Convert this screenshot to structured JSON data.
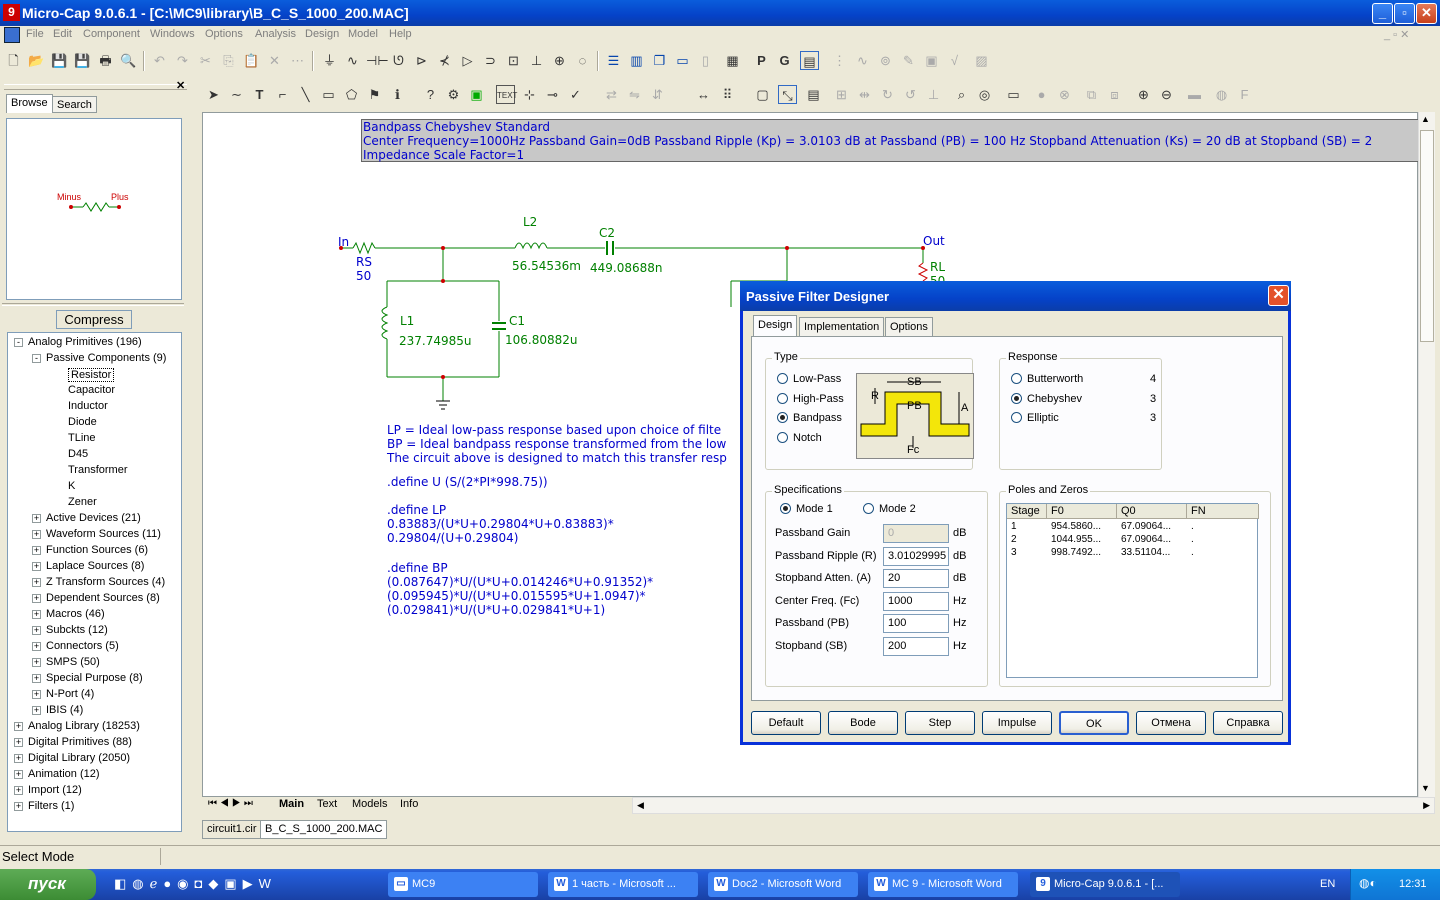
{
  "window": {
    "title": "Micro-Cap 9.0.6.1 - [C:\\MC9\\library\\B_C_S_1000_200.MAC]",
    "min": "_",
    "max": "▫",
    "close": "✕"
  },
  "menu": [
    "File",
    "Edit",
    "Component",
    "Windows",
    "Options",
    "Analysis",
    "Design",
    "Model",
    "Help"
  ],
  "left": {
    "tabs": [
      "Browse",
      "Search"
    ],
    "preview_pins": {
      "minus": "Minus",
      "plus": "Plus"
    },
    "compress": "Compress",
    "tree": [
      {
        "label": "Analog Primitives (196)",
        "level": 0,
        "exp": "-"
      },
      {
        "label": "Passive Components (9)",
        "level": 1,
        "exp": "-"
      },
      {
        "label": "Resistor",
        "level": 2,
        "exp": "",
        "sel": true
      },
      {
        "label": "Capacitor",
        "level": 2,
        "exp": ""
      },
      {
        "label": "Inductor",
        "level": 2,
        "exp": ""
      },
      {
        "label": "Diode",
        "level": 2,
        "exp": ""
      },
      {
        "label": "TLine",
        "level": 2,
        "exp": ""
      },
      {
        "label": "D45",
        "level": 2,
        "exp": ""
      },
      {
        "label": "Transformer",
        "level": 2,
        "exp": ""
      },
      {
        "label": "K",
        "level": 2,
        "exp": ""
      },
      {
        "label": "Zener",
        "level": 2,
        "exp": ""
      },
      {
        "label": "Active Devices (21)",
        "level": 1,
        "exp": "+"
      },
      {
        "label": "Waveform Sources (11)",
        "level": 1,
        "exp": "+"
      },
      {
        "label": "Function Sources (6)",
        "level": 1,
        "exp": "+"
      },
      {
        "label": "Laplace Sources (8)",
        "level": 1,
        "exp": "+"
      },
      {
        "label": "Z Transform Sources (4)",
        "level": 1,
        "exp": "+"
      },
      {
        "label": "Dependent Sources (8)",
        "level": 1,
        "exp": "+"
      },
      {
        "label": "Macros (46)",
        "level": 1,
        "exp": "+"
      },
      {
        "label": "Subckts (12)",
        "level": 1,
        "exp": "+"
      },
      {
        "label": "Connectors (5)",
        "level": 1,
        "exp": "+"
      },
      {
        "label": "SMPS (50)",
        "level": 1,
        "exp": "+"
      },
      {
        "label": "Special Purpose (8)",
        "level": 1,
        "exp": "+"
      },
      {
        "label": "N-Port (4)",
        "level": 1,
        "exp": "+"
      },
      {
        "label": "IBIS (4)",
        "level": 1,
        "exp": "+"
      },
      {
        "label": "Analog Library (18253)",
        "level": 0,
        "exp": "+"
      },
      {
        "label": "Digital Primitives (88)",
        "level": 0,
        "exp": "+"
      },
      {
        "label": "Digital Library (2050)",
        "level": 0,
        "exp": "+"
      },
      {
        "label": "Animation (12)",
        "level": 0,
        "exp": "+"
      },
      {
        "label": "Import (12)",
        "level": 0,
        "exp": "+"
      },
      {
        "label": "Filters (1)",
        "level": 0,
        "exp": "+"
      }
    ]
  },
  "schematic": {
    "header": [
      "Bandpass Chebyshev Standard",
      "Center Frequency=1000Hz Passband Gain=0dB Passband Ripple (Kp) = 3.0103 dB at Passband (PB) = 100 Hz  Stopband Attenuation (Ks) = 20 dB at Stopband (SB) = 2",
      "Impedance Scale Factor=1"
    ],
    "labels": {
      "in": "In",
      "out": "Out",
      "rs": "RS",
      "rs_val": "50",
      "l2": "L2",
      "l2_val": "56.54536m",
      "c2": "C2",
      "c2_val": "449.08688n",
      "l1": "L1",
      "l1_val": "237.74985u",
      "c1": "C1",
      "c1_val": "106.80882u",
      "rl": "RL",
      "rl_val": "50"
    },
    "notes": [
      "LP = Ideal low-pass response based upon choice of filte",
      "BP = Ideal bandpass response transformed from the low",
      "The circuit above is designed to match this transfer resp"
    ],
    "defines": [
      ".define U (S/(2*PI*998.75))",
      ".define LP",
      "0.83883/(U*U+0.29804*U+0.83883)*",
      "0.29804/(U+0.29804)",
      ".define BP",
      "(0.087647)*U/(U*U+0.014246*U+0.91352)*",
      "(0.095945)*U/(U*U+0.015595*U+1.0947)*",
      "(0.029841)*U/(U*U+0.029841*U+1)"
    ],
    "sheet_tabs": [
      "Main",
      "Text",
      "Models",
      "Info"
    ],
    "file_tabs": [
      "circuit1.cir",
      "B_C_S_1000_200.MAC"
    ]
  },
  "status": "Select Mode",
  "dialog": {
    "title": "Passive Filter Designer",
    "tabs": [
      "Design",
      "Implementation",
      "Options"
    ],
    "type": {
      "title": "Type",
      "options": [
        "Low-Pass",
        "High-Pass",
        "Bandpass",
        "Notch"
      ],
      "selected": 2
    },
    "diagram": {
      "sb": "SB",
      "pb": "PB",
      "r": "R",
      "a": "A",
      "fc": "Fc"
    },
    "response": {
      "title": "Response",
      "options": [
        {
          "name": "Butterworth",
          "n": "4"
        },
        {
          "name": "Chebyshev",
          "n": "3"
        },
        {
          "name": "Elliptic",
          "n": "3"
        }
      ],
      "selected": 1
    },
    "specs": {
      "title": "Specifications",
      "mode1": "Mode 1",
      "mode2": "Mode 2",
      "rows": [
        {
          "label": "Passband Gain",
          "value": "0",
          "unit": "dB",
          "disabled": true
        },
        {
          "label": "Passband Ripple (R)",
          "value": "3.01029995",
          "unit": "dB"
        },
        {
          "label": "Stopband Atten. (A)",
          "value": "20",
          "unit": "dB"
        },
        {
          "label": "Center Freq. (Fc)",
          "value": "1000",
          "unit": "Hz"
        },
        {
          "label": "Passband (PB)",
          "value": "100",
          "unit": "Hz"
        },
        {
          "label": "Stopband (SB)",
          "value": "200",
          "unit": "Hz"
        }
      ]
    },
    "poles": {
      "title": "Poles and Zeros",
      "headers": [
        "Stage",
        "F0",
        "Q0",
        "FN"
      ],
      "rows": [
        [
          "1",
          "954.5860...",
          "67.09064...",
          "."
        ],
        [
          "2",
          "1044.955...",
          "67.09064...",
          "."
        ],
        [
          "3",
          "998.7492...",
          "33.51104...",
          "."
        ]
      ]
    },
    "buttons": [
      "Default",
      "Bode",
      "Step",
      "Impulse",
      "OK",
      "Отмена",
      "Справка"
    ]
  },
  "taskbar": {
    "start": "пуск",
    "tasks": [
      "MC9",
      "1 часть - Microsoft ...",
      "Doc2 - Microsoft Word",
      "MC 9 - Microsoft Word",
      "Micro-Cap 9.0.6.1 - [..."
    ],
    "lang": "EN",
    "time": "12:31"
  }
}
